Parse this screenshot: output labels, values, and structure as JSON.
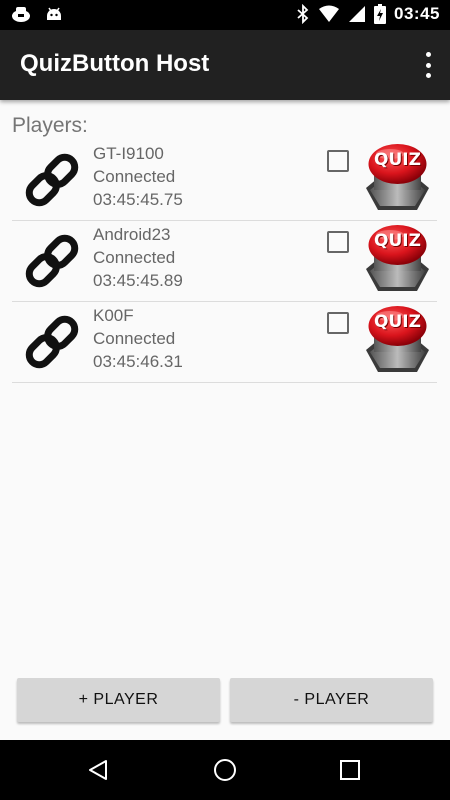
{
  "status_bar": {
    "time": "03:45",
    "left_icons": [
      "quiz-notification-icon",
      "android-notification-icon"
    ],
    "right_icons": [
      "bluetooth-icon",
      "wifi-icon",
      "signal-icon",
      "battery-charging-icon"
    ]
  },
  "app_bar": {
    "title": "QuizButton Host",
    "overflow_icon": "more-vert-icon"
  },
  "players_label": "Players:",
  "players": [
    {
      "name": "GT-I9100",
      "status": "Connected",
      "time": "03:45:45.75",
      "checked": false,
      "button_text": "QUIZ"
    },
    {
      "name": "Android23",
      "status": "Connected",
      "time": "03:45:45.89",
      "checked": false,
      "button_text": "QUIZ"
    },
    {
      "name": "K00F",
      "status": "Connected",
      "time": "03:45:46.31",
      "checked": false,
      "button_text": "QUIZ"
    }
  ],
  "buttons": {
    "add_player": "+ PLAYER",
    "remove_player": "- PLAYER"
  },
  "nav_bar": {
    "items": [
      "back-icon",
      "home-icon",
      "recents-icon"
    ]
  },
  "colors": {
    "app_bar": "#212121",
    "background": "#fafafa",
    "quiz_red": "#d9141c",
    "button_gray": "#d6d6d6"
  }
}
